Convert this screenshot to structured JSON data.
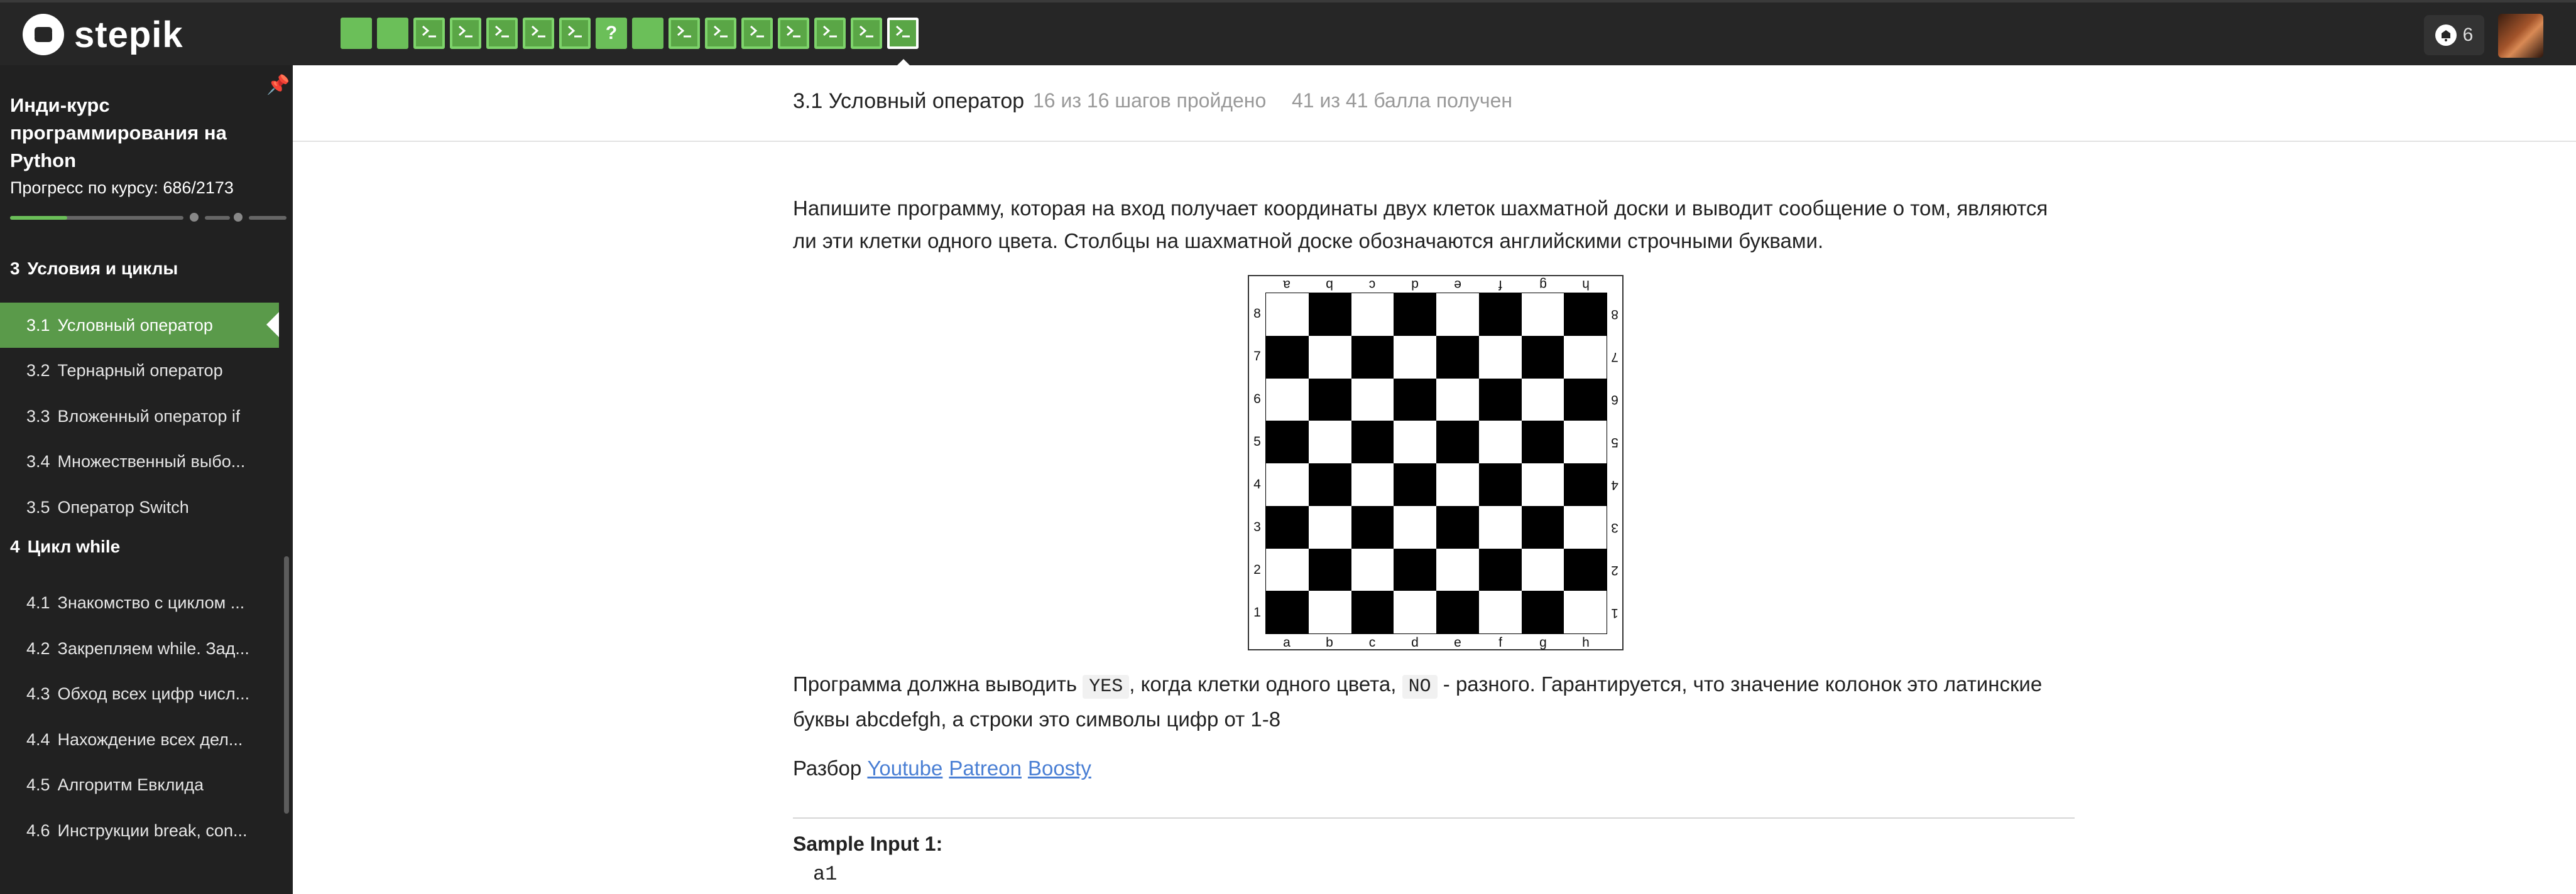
{
  "app": {
    "logo_text": "stepik"
  },
  "topbar": {
    "steps": [
      {
        "kind": "text",
        "icon": "text-step-icon"
      },
      {
        "kind": "text",
        "icon": "text-step-icon"
      },
      {
        "kind": "code",
        "icon": "terminal-icon"
      },
      {
        "kind": "code",
        "icon": "terminal-icon"
      },
      {
        "kind": "code",
        "icon": "terminal-icon"
      },
      {
        "kind": "code",
        "icon": "terminal-icon"
      },
      {
        "kind": "code",
        "icon": "terminal-icon"
      },
      {
        "kind": "quiz",
        "icon": "question-icon",
        "label": "?"
      },
      {
        "kind": "text",
        "icon": "text-step-icon"
      },
      {
        "kind": "code",
        "icon": "terminal-icon"
      },
      {
        "kind": "code",
        "icon": "terminal-icon"
      },
      {
        "kind": "code",
        "icon": "terminal-icon"
      },
      {
        "kind": "code",
        "icon": "terminal-icon"
      },
      {
        "kind": "code",
        "icon": "terminal-icon"
      },
      {
        "kind": "code",
        "icon": "terminal-icon"
      },
      {
        "kind": "code",
        "icon": "terminal-icon",
        "current": true
      }
    ],
    "notifications_count": "6",
    "colors": {
      "bar": "#262626",
      "step_passed": "#6bbf59"
    }
  },
  "sidebar": {
    "course_title": "Инди-курс программирования на Python",
    "progress_label": "Прогресс по курсу:",
    "progress_value": "686/2173",
    "progress_fraction": 0.316,
    "modules": [
      {
        "number": "3",
        "title": "Условия и циклы",
        "lessons": [
          {
            "num": "3.1",
            "title": "Условный оператор",
            "active": true
          },
          {
            "num": "3.2",
            "title": "Тернарный оператор"
          },
          {
            "num": "3.3",
            "title": "Вложенный оператор if"
          },
          {
            "num": "3.4",
            "title": "Множественный выбо..."
          },
          {
            "num": "3.5",
            "title": "Оператор Switch"
          }
        ]
      },
      {
        "number": "4",
        "title": "Цикл while",
        "lessons": [
          {
            "num": "4.1",
            "title": "Знакомство с циклом ..."
          },
          {
            "num": "4.2",
            "title": "Закрепляем while. Зад..."
          },
          {
            "num": "4.3",
            "title": "Обход всех цифр числ..."
          },
          {
            "num": "4.4",
            "title": "Нахождение всех дел..."
          },
          {
            "num": "4.5",
            "title": "Алгоритм Евклида"
          },
          {
            "num": "4.6",
            "title": "Инструкции break, con..."
          }
        ]
      }
    ],
    "colors": {
      "bg": "#212121",
      "active": "#5a9a4a"
    }
  },
  "lesson_header": {
    "title": "3.1 Условный оператор",
    "steps_status": "16 из 16 шагов пройдено",
    "score_status": "41 из 41 балла  получен"
  },
  "content": {
    "intro": "Напишите программу, которая на вход получает координаты двух клеток шахматной доски и выводит сообщение о том, являются ли эти клетки одного цвета. Столбцы на шахматной доске обозначаются английскими строчными буквами.",
    "board": {
      "files": [
        "a",
        "b",
        "c",
        "d",
        "e",
        "f",
        "g",
        "h"
      ],
      "ranks": [
        "8",
        "7",
        "6",
        "5",
        "4",
        "3",
        "2",
        "1"
      ]
    },
    "output_p1": "Программа должна выводить ",
    "yes_code": "YES",
    "output_p2": ", когда клетки одного цвета, ",
    "no_code": "NO",
    "output_p3": " - разного. Гарантируется, что значение колонок это латинские буквы abcdefgh, а строки это символы цифр от 1-8",
    "analysis_label": "Разбор",
    "links": [
      "Youtube",
      "Patreon",
      "Boosty"
    ],
    "sample_input_title": "Sample Input 1:",
    "sample_input_value": "a1",
    "link_color": "#4a7fd4"
  }
}
